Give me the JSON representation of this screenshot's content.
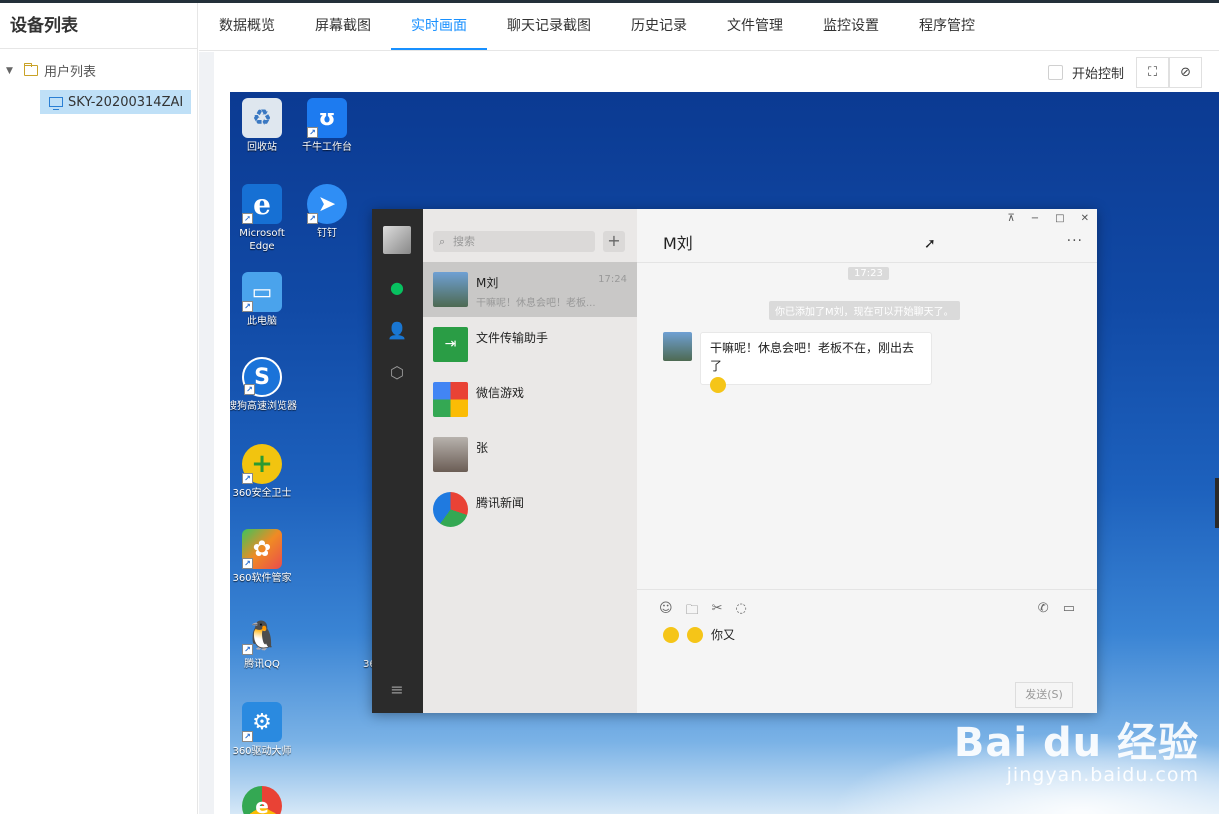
{
  "sidebar": {
    "title": "设备列表",
    "tree_root": "用户列表",
    "device": "SKY-20200314ZAI"
  },
  "tabs": [
    {
      "label": "数据概览"
    },
    {
      "label": "屏幕截图"
    },
    {
      "label": "实时画面",
      "active": true
    },
    {
      "label": "聊天记录截图"
    },
    {
      "label": "历史记录"
    },
    {
      "label": "文件管理"
    },
    {
      "label": "监控设置"
    },
    {
      "label": "程序管控"
    }
  ],
  "toolbar": {
    "control_label": "开始控制",
    "control_checked": false
  },
  "desktop": {
    "icons": [
      {
        "label": "回收站",
        "icon": "recycle-bin-icon"
      },
      {
        "label": "千牛工作台",
        "icon": "qianniu-icon"
      },
      {
        "label": "Microsoft Edge",
        "icon": "edge-icon"
      },
      {
        "label": "钉钉",
        "icon": "dingtalk-icon"
      },
      {
        "label": "此电脑",
        "icon": "computer-icon"
      },
      {
        "label": "搜狗高速浏览器",
        "icon": "sogou-browser-icon"
      },
      {
        "label": "360安全卫士",
        "icon": "360-security-icon"
      },
      {
        "label": "360软件管家",
        "icon": "360-software-icon"
      },
      {
        "label": "腾讯QQ",
        "icon": "qq-icon"
      },
      {
        "label": "360驱动大师",
        "icon": "360-driver-icon"
      },
      {
        "label": "",
        "icon": "browser-icon"
      }
    ],
    "stray_text": "36"
  },
  "wechat": {
    "search_placeholder": "搜索",
    "chat_title": "M刘",
    "conversations": [
      {
        "name": "M刘",
        "time": "17:24",
        "preview": "干嘛呢！休息会吧！老板...",
        "selected": true
      },
      {
        "name": "文件传输助手",
        "time": "",
        "preview": ""
      },
      {
        "name": "微信游戏",
        "time": "",
        "preview": ""
      },
      {
        "name": "张",
        "time": "",
        "preview": ""
      },
      {
        "name": "腾讯新闻",
        "time": "",
        "preview": ""
      }
    ],
    "message_time": "17:23",
    "system_notice": "你已添加了M刘，现在可以开始聊天了。",
    "message_text": "干嘛呢！休息会吧！老板不在，刚出去了",
    "input_text": "你又",
    "send_label": "发送(S)"
  },
  "watermark": {
    "main": "Bai du 经验",
    "sub": "jingyan.baidu.com"
  },
  "colors": {
    "accent": "#1890ff",
    "selected_node": "#bfe0f7",
    "wechat_green": "#07c160"
  }
}
